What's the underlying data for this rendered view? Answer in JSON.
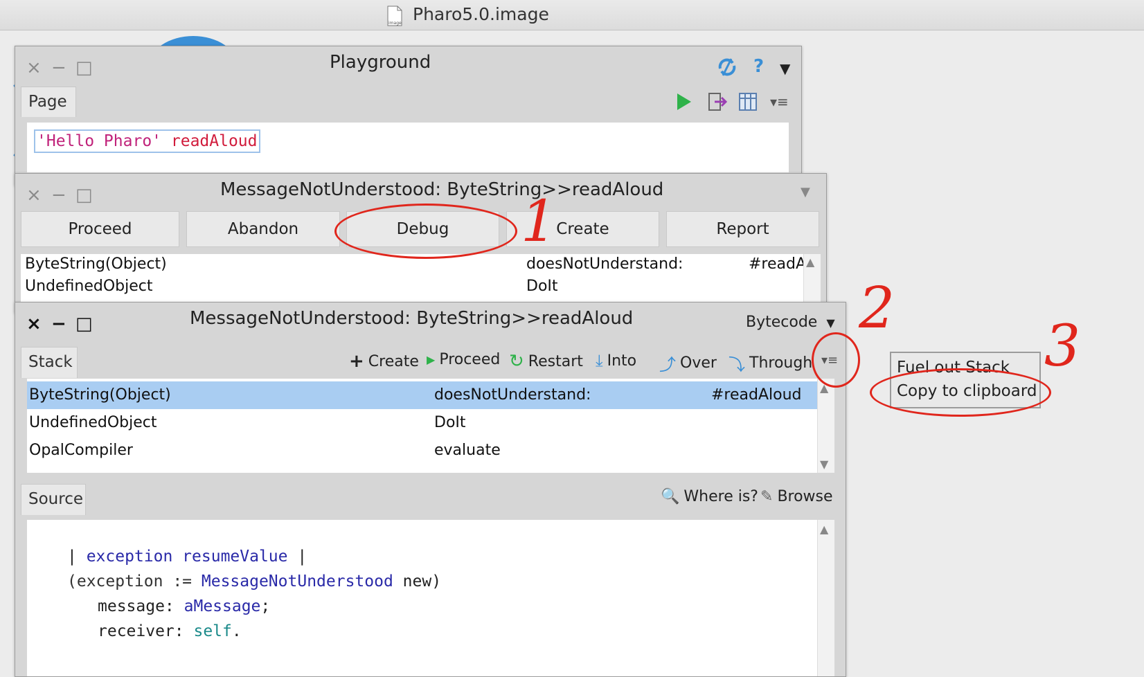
{
  "os_window": {
    "title": "Pharo5.0.image"
  },
  "playground": {
    "title": "Playground",
    "tab": "Page",
    "code_string": "'Hello Pharo'",
    "code_selector": "readAloud"
  },
  "notifier": {
    "title": "MessageNotUnderstood: ByteString>>readAloud",
    "buttons": [
      "Proceed",
      "Abandon",
      "Debug",
      "Create",
      "Report"
    ],
    "stack": [
      {
        "receiver": "ByteString(Object)",
        "method": "doesNotUnderstand:",
        "arg": "#readAl"
      },
      {
        "receiver": "UndefinedObject",
        "method": "DoIt",
        "arg": ""
      }
    ]
  },
  "debugger": {
    "title": "MessageNotUnderstood: ByteString>>readAloud",
    "mode": "Bytecode",
    "stack_tab": "Stack",
    "toolbar": {
      "create": "Create",
      "proceed": "Proceed",
      "restart": "Restart",
      "into": "Into",
      "over": "Over",
      "through": "Through"
    },
    "stack": [
      {
        "receiver": "ByteString(Object)",
        "method": "doesNotUnderstand:",
        "arg": "#readAloud"
      },
      {
        "receiver": "UndefinedObject",
        "method": "DoIt",
        "arg": ""
      },
      {
        "receiver": "OpalCompiler",
        "method": "evaluate",
        "arg": ""
      }
    ],
    "source_tab": "Source",
    "where_is": "Where is?",
    "browse": "Browse",
    "source": {
      "l1_temps": "exception resumeValue",
      "l2_open": "(exception := ",
      "l2_class": "MessageNotUnderstood",
      "l2_msg": " new)",
      "l3_kw": "message: ",
      "l3_arg": "aMessage",
      "l3_end": ";",
      "l4_kw": "receiver: ",
      "l4_arg": "self",
      "l4_end": "."
    }
  },
  "context_menu": {
    "items": [
      "Fuel out Stack",
      "Copy to clipboard"
    ]
  },
  "annotations": [
    "1",
    "2",
    "3"
  ],
  "colors": {
    "annotation": "#e0261c",
    "selection": "#a9cdf2",
    "run": "#2fb24a"
  }
}
